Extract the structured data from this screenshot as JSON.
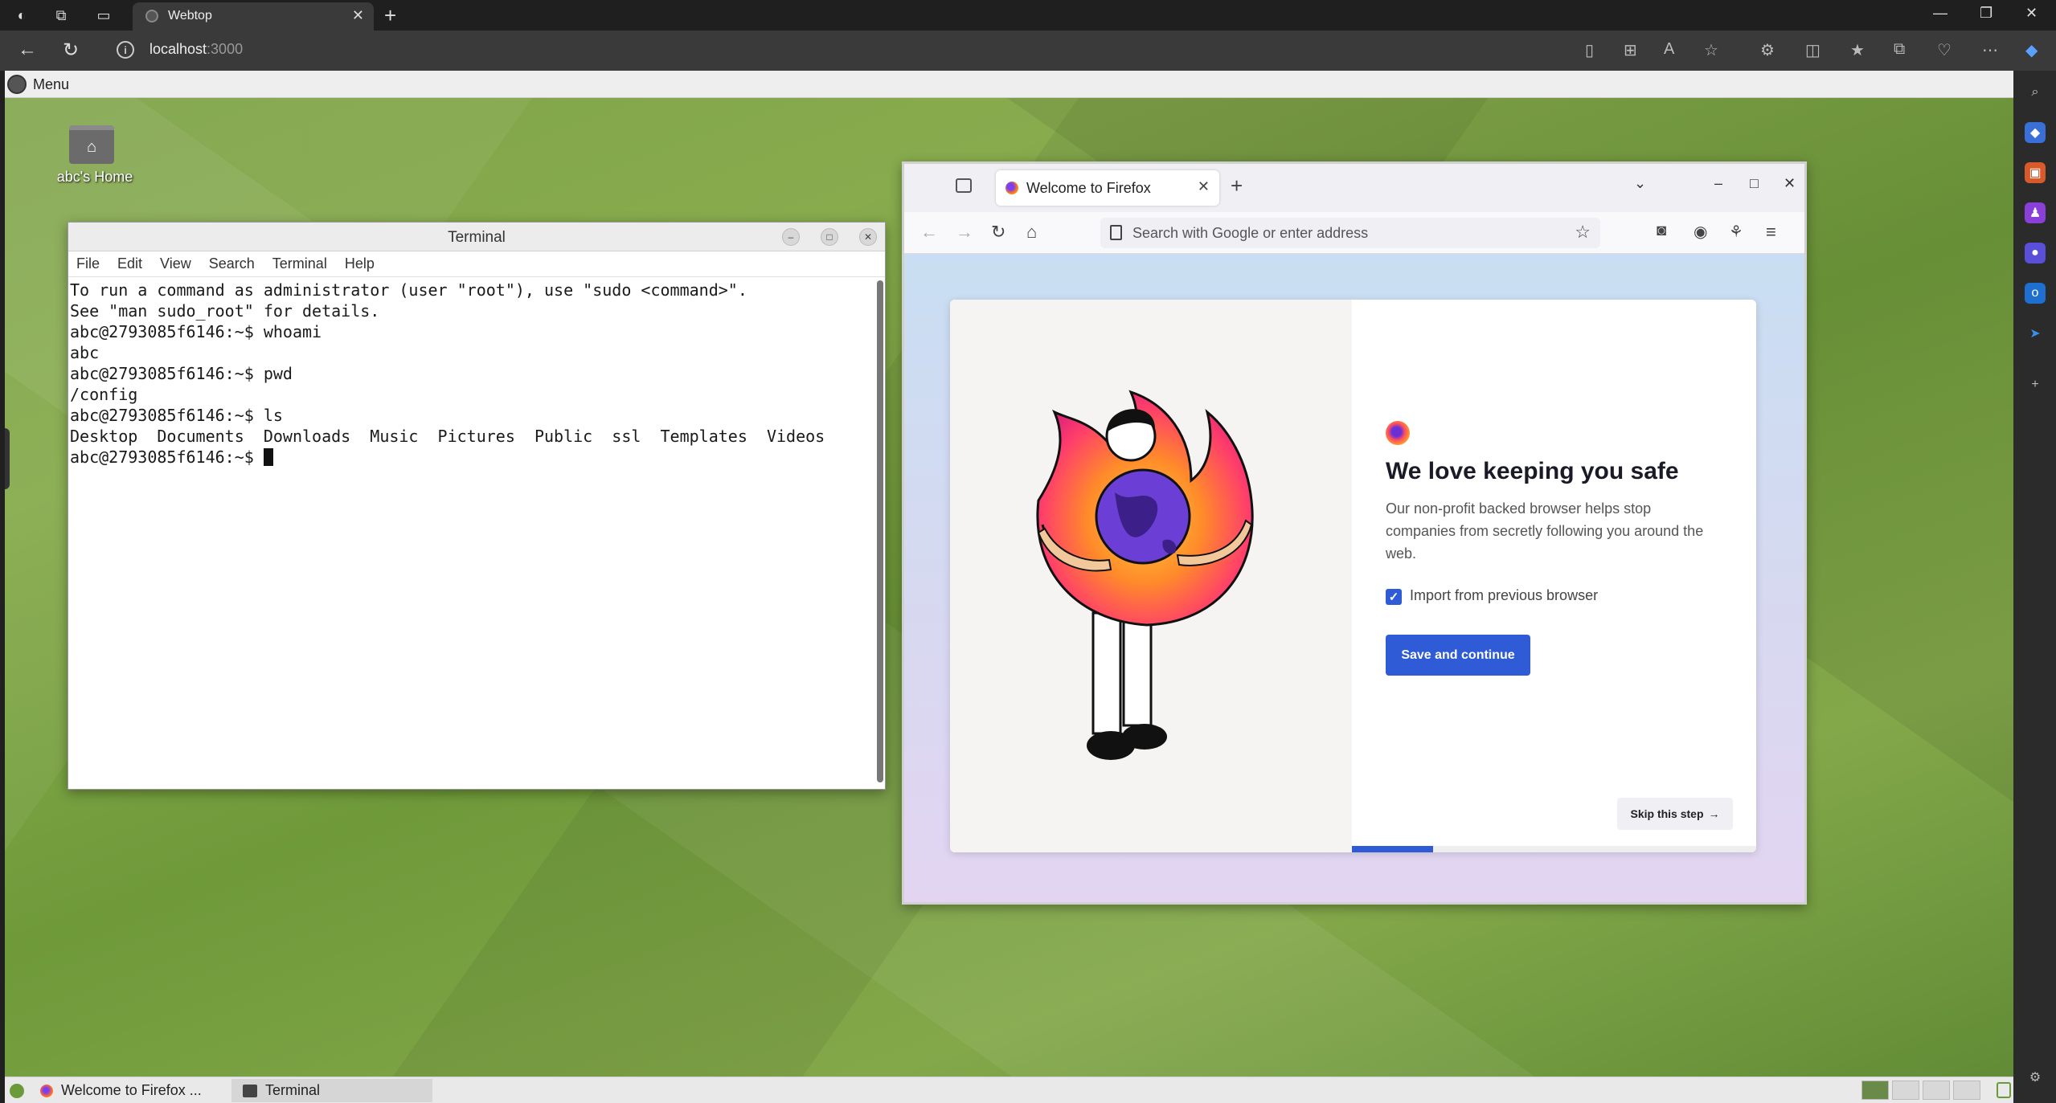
{
  "browser": {
    "tab_title": "Webtop",
    "url_host": "localhost",
    "url_port": ":3000"
  },
  "desktop": {
    "menu_label": "Menu",
    "home_icon_label": "abc's Home"
  },
  "terminal": {
    "title": "Terminal",
    "menu": [
      "File",
      "Edit",
      "View",
      "Search",
      "Terminal",
      "Help"
    ],
    "lines": [
      "To run a command as administrator (user \"root\"), use \"sudo <command>\".",
      "See \"man sudo_root\" for details.",
      "",
      "abc@2793085f6146:~$ whoami",
      "abc",
      "abc@2793085f6146:~$ pwd",
      "/config",
      "abc@2793085f6146:~$ ls",
      "Desktop  Documents  Downloads  Music  Pictures  Public  ssl  Templates  Videos"
    ],
    "prompt": "abc@2793085f6146:~$ "
  },
  "firefox": {
    "tab_title": "Welcome to Firefox",
    "address_placeholder": "Search with Google or enter address",
    "headline": "We love keeping you safe",
    "subtext": "Our non-profit backed browser helps stop companies from secretly following you around the web.",
    "checkbox_label": "Import from previous browser",
    "checkbox_checked": true,
    "primary_button": "Save and continue",
    "skip_button": "Skip this step",
    "onboarding_progress": 0.2
  },
  "taskbar": {
    "items": [
      "Welcome to Firefox ...",
      "Terminal"
    ]
  },
  "colors": {
    "accent": "#2f5bd6",
    "desktop_green": "#7ea348"
  }
}
